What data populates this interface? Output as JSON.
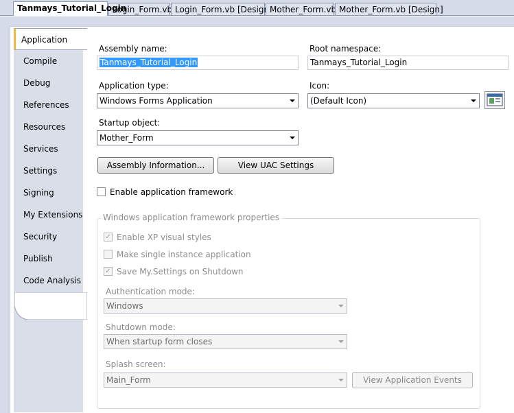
{
  "doc_tabs": [
    {
      "label": "Tanmays_Tutorial_Login",
      "active": true
    },
    {
      "label": "Login_Form.vb"
    },
    {
      "label": "Login_Form.vb [Design]"
    },
    {
      "label": "Mother_Form.vb"
    },
    {
      "label": "Mother_Form.vb [Design]"
    }
  ],
  "side_tabs": [
    "Application",
    "Compile",
    "Debug",
    "References",
    "Resources",
    "Services",
    "Settings",
    "Signing",
    "My Extensions",
    "Security",
    "Publish",
    "Code Analysis"
  ],
  "assembly_name": {
    "label": "Assembly name:",
    "value": "Tanmays_Tutorial_Login"
  },
  "root_namespace": {
    "label": "Root namespace:",
    "value": "Tanmays_Tutorial_Login"
  },
  "application_type": {
    "label": "Application type:",
    "value": "Windows Forms Application"
  },
  "icon": {
    "label": "Icon:",
    "value": "(Default Icon)"
  },
  "startup_object": {
    "label": "Startup object:",
    "value": "Mother_Form"
  },
  "buttons": {
    "assembly_info": "Assembly Information...",
    "view_uac": "View UAC Settings",
    "view_app_events": "View Application Events"
  },
  "enable_framework": {
    "label": "Enable application framework",
    "checked": false
  },
  "framework_group": {
    "title": "Windows application framework properties",
    "xp_styles": {
      "label": "Enable XP visual styles",
      "checked": true
    },
    "single_instance": {
      "label": "Make single instance application",
      "checked": false
    },
    "save_settings": {
      "label": "Save My.Settings on Shutdown",
      "checked": true
    },
    "auth_mode": {
      "label": "Authentication mode:",
      "value": "Windows"
    },
    "shutdown_mode": {
      "label": "Shutdown mode:",
      "value": "When startup form closes"
    },
    "splash_screen": {
      "label": "Splash screen:",
      "value": "Main_Form"
    }
  },
  "colors": {
    "active_tab_accent": "#f0b845",
    "selection": "#3399ff"
  }
}
